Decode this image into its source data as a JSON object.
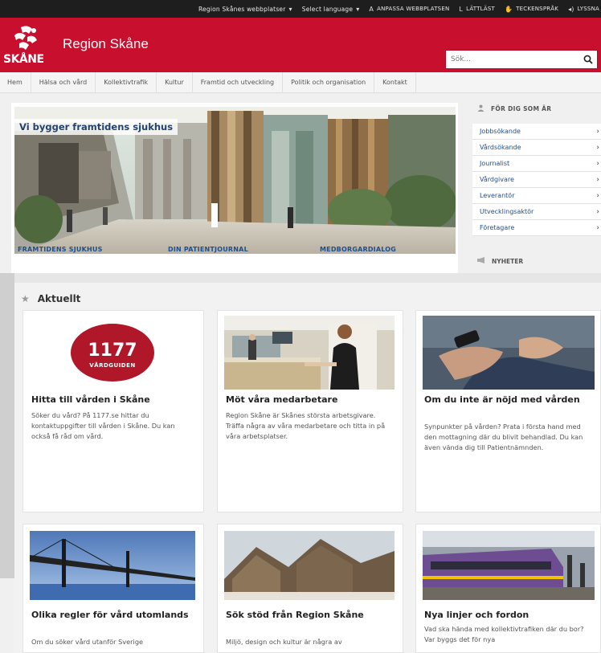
{
  "utility_bar": {
    "sites": "Region Skånes webbplatser",
    "language": "Select language",
    "customize": "ANPASSA WEBBPLATSEN",
    "easy_read": "LÄTTLÄST",
    "sign_language": "TECKENSPRÅK",
    "listen": "LYSSNA"
  },
  "header": {
    "logo_text": "SKÅNE",
    "title": "Region Skåne",
    "search_placeholder": "Sök..."
  },
  "nav": [
    "Hem",
    "Hälsa och vård",
    "Kollektivtrafik",
    "Kultur",
    "Framtid och utveckling",
    "Politik och organisation",
    "Kontakt"
  ],
  "hero": {
    "caption": "Vi bygger framtidens sjukhus",
    "links": [
      "FRAMTIDENS SJUKHUS",
      "DIN PATIENTJOURNAL",
      "MEDBORGARDIALOG"
    ]
  },
  "sidebar": {
    "heading": "FÖR DIG SOM ÄR",
    "items": [
      "Jobbsökande",
      "Vårdsökande",
      "Journalist",
      "Vårdgivare",
      "Leverantör",
      "Utvecklingsaktör",
      "Företagare"
    ],
    "news_heading": "NYHETER"
  },
  "aktuellt": {
    "title": "Aktuellt",
    "cards": [
      {
        "title": "Hitta till vården i Skåne",
        "text": "Söker du vård? På 1177.se hittar du kontaktuppgifter till vården i Skåne. Du kan också få råd om vård.",
        "logo_top": "1177",
        "logo_bottom": "VÅRDGUIDEN"
      },
      {
        "title": "Möt våra medarbetare",
        "text": "Region Skåne är Skånes största arbetsgivare. Träffa några av våra medarbetare och titta in på våra arbetsplatser."
      },
      {
        "title": "Om du inte är nöjd med vården",
        "text": "Synpunkter på vården? Prata i första hand med den mottagning där du blivit behandlad. Du kan även vända dig till Patientnämnden."
      },
      {
        "title": "Olika regler för vård utomlands",
        "text": "Om du söker vård utanför Sverige"
      },
      {
        "title": "Sök stöd från Region Skåne",
        "text": "Miljö, design och kultur är några av"
      },
      {
        "title": "Nya linjer och fordon",
        "text": "Vad ska hända med kollektivtrafiken där du bor? Var byggs det för nya"
      }
    ]
  }
}
